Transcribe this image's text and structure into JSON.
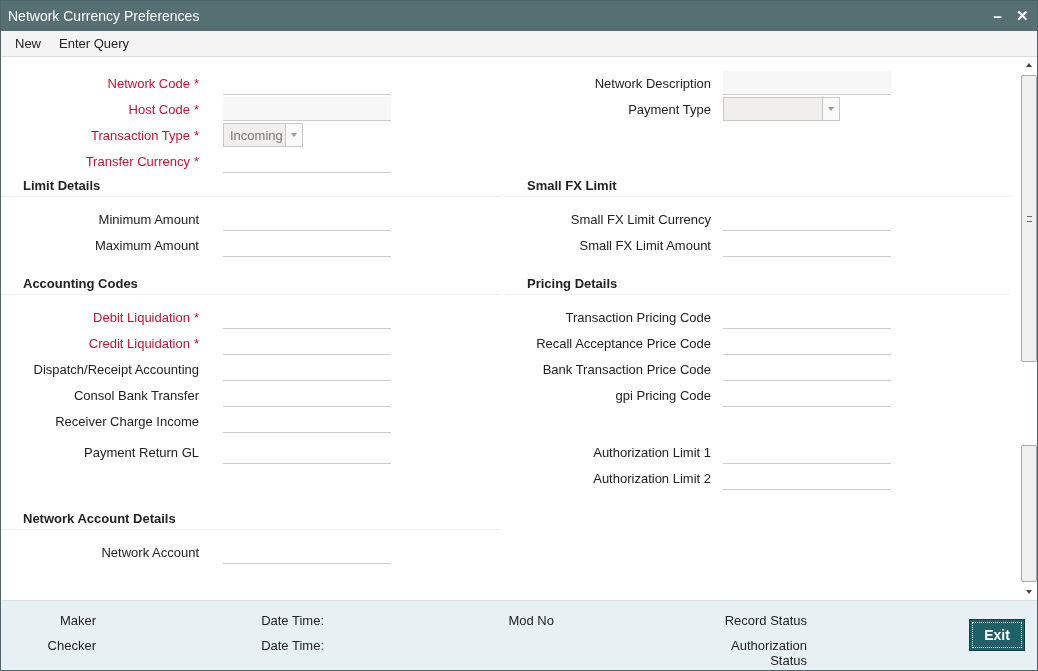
{
  "window": {
    "title": "Network Currency Preferences",
    "controls": [
      "−",
      "✕"
    ]
  },
  "menu": [
    "New",
    "Enter Query"
  ],
  "top": {
    "left": [
      {
        "label": "Network Code",
        "required": true,
        "mark": "*",
        "kind": "text"
      },
      {
        "label": "Host Code",
        "required": true,
        "mark": "*",
        "kind": "readonly"
      },
      {
        "label": "Transaction Type",
        "required": true,
        "mark": "*",
        "kind": "select",
        "value": "Incoming"
      },
      {
        "label": "Transfer Currency",
        "required": true,
        "mark": "*",
        "kind": "text"
      }
    ],
    "right": [
      {
        "label": "Network Description",
        "required": false,
        "kind": "readonly"
      },
      {
        "label": "Payment Type",
        "required": false,
        "kind": "select"
      }
    ]
  },
  "sections": [
    {
      "left": {
        "title": "Limit Details",
        "groups": [
          [
            {
              "label": "Minimum Amount",
              "required": false,
              "kind": "text"
            },
            {
              "label": "Maximum Amount",
              "required": false,
              "kind": "text"
            }
          ]
        ]
      },
      "right": {
        "title": "Small FX Limit",
        "groups": [
          [
            {
              "label": "Small FX Limit Currency",
              "required": false,
              "kind": "text"
            },
            {
              "label": "Small FX Limit Amount",
              "required": false,
              "kind": "text"
            }
          ]
        ]
      }
    },
    {
      "left": {
        "title": "Accounting Codes",
        "groups": [
          [
            {
              "label": "Debit Liquidation",
              "required": true,
              "mark": "*",
              "kind": "text"
            },
            {
              "label": "Credit Liquidation",
              "required": true,
              "mark": "*",
              "kind": "text"
            },
            {
              "label": "Dispatch/Receipt Accounting",
              "required": false,
              "kind": "text"
            },
            {
              "label": "Consol Bank Transfer",
              "required": false,
              "kind": "text"
            },
            {
              "label": "Receiver Charge Income",
              "required": false,
              "kind": "text"
            }
          ],
          [
            {
              "label": "Payment Return GL",
              "required": false,
              "kind": "text"
            }
          ]
        ]
      },
      "right": {
        "title": "Pricing Details",
        "groups": [
          [
            {
              "label": "Transaction Pricing Code",
              "required": false,
              "kind": "text"
            },
            {
              "label": "Recall Acceptance Price Code",
              "required": false,
              "kind": "text"
            },
            {
              "label": "Bank Transaction Price Code",
              "required": false,
              "kind": "text"
            },
            {
              "label": "gpi Pricing Code",
              "required": false,
              "kind": "text"
            }
          ],
          [
            {
              "label": "Authorization Limit 1",
              "required": false,
              "kind": "text"
            },
            {
              "label": "Authorization Limit 2",
              "required": false,
              "kind": "text"
            }
          ]
        ]
      }
    },
    {
      "left": {
        "title": "Network Account Details",
        "groups": [
          [
            {
              "label": "Network Account",
              "required": false,
              "kind": "text"
            }
          ]
        ]
      }
    }
  ],
  "footer": {
    "columns": [
      [
        "Maker",
        "Checker"
      ],
      [
        "Date Time:",
        "Date Time:"
      ],
      [
        "Mod No"
      ],
      [
        "Record Status",
        "Authorization Status"
      ]
    ],
    "button": "Exit"
  }
}
